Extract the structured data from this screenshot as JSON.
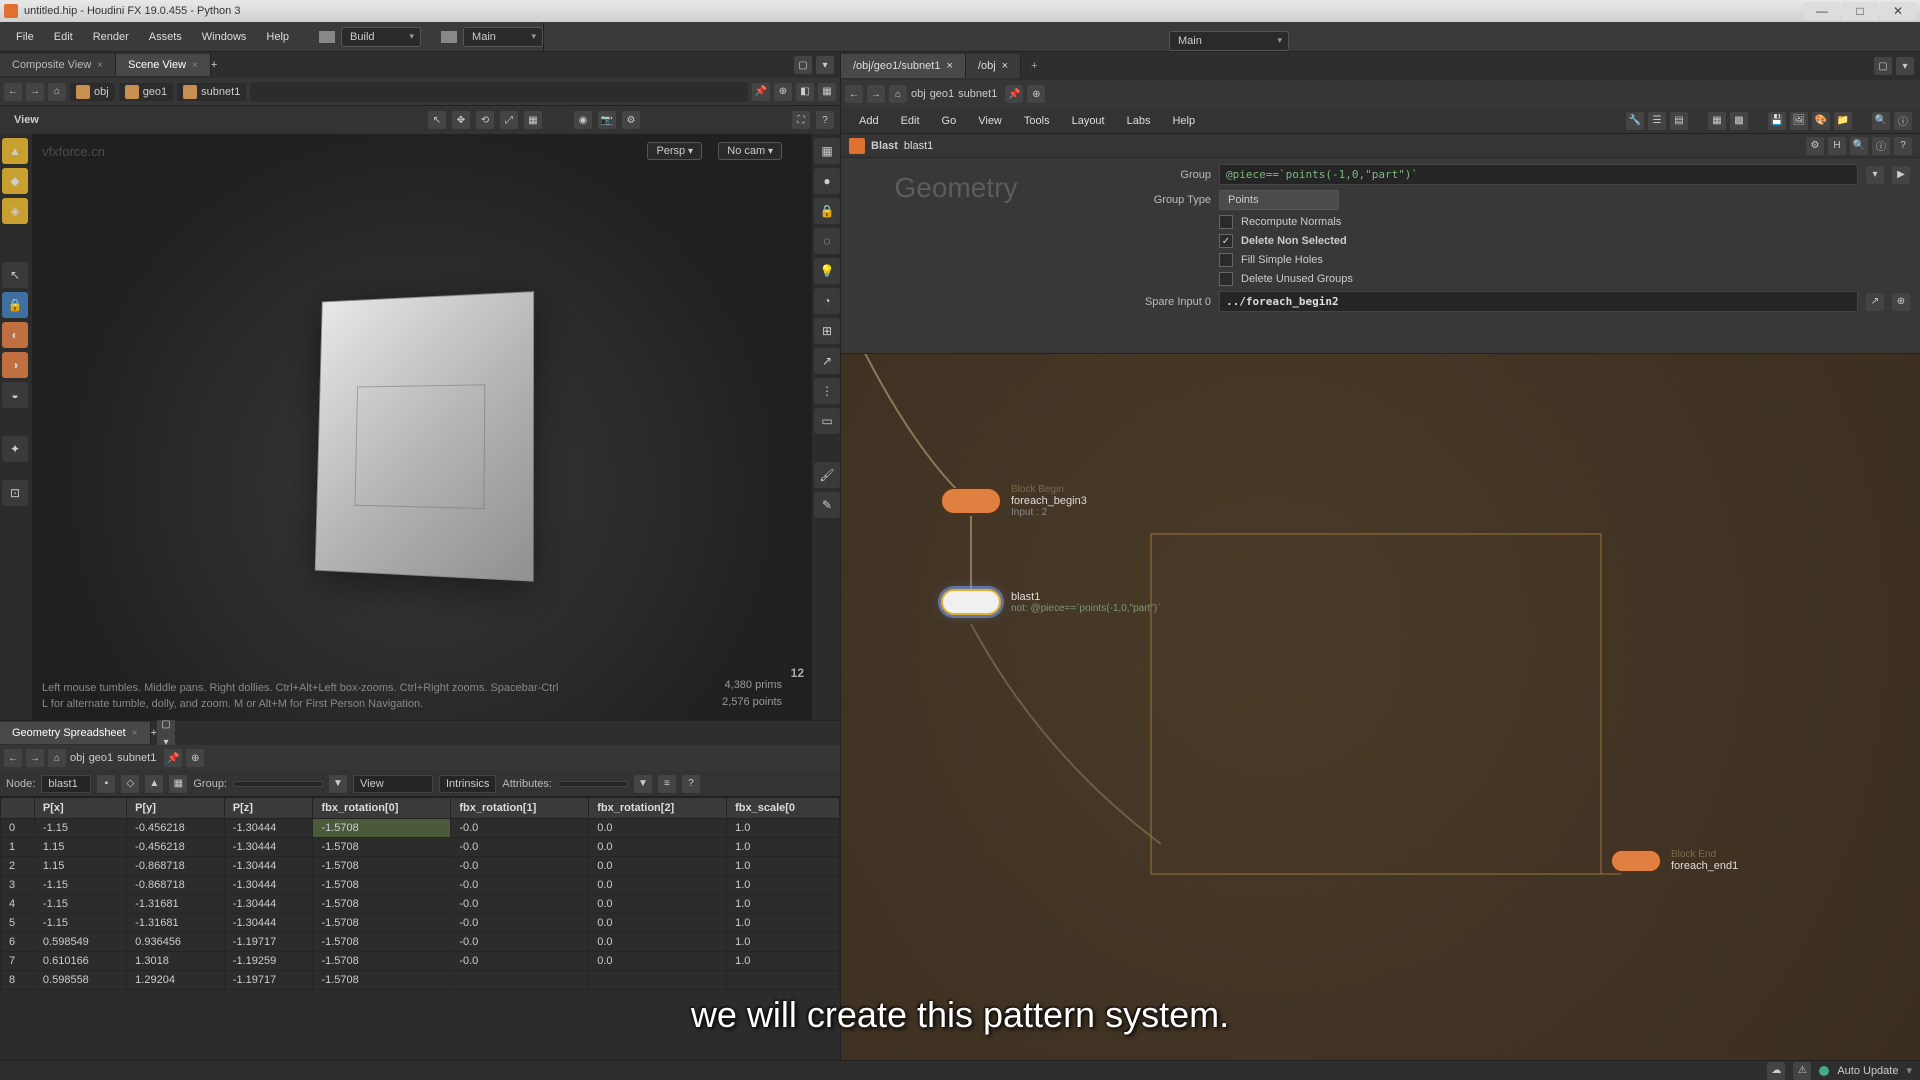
{
  "title": "untitled.hip - Houdini FX 19.0.455 - Python 3",
  "menubar": [
    "File",
    "Edit",
    "Render",
    "Assets",
    "Windows",
    "Help"
  ],
  "desktop_build": "Build",
  "desktop_main": "Main",
  "desktop_main2": "Main",
  "viewer_tabs": {
    "composite": "Composite View",
    "scene": "Scene View"
  },
  "path": {
    "obj": "obj",
    "geo1": "geo1",
    "subnet1": "subnet1"
  },
  "sv_toolbar": {
    "view": "View"
  },
  "viewport": {
    "watermark": "vfxforce.cn",
    "persp": "Persp",
    "cam": "No cam",
    "hint1": "Left mouse tumbles. Middle pans. Right dollies. Ctrl+Alt+Left box-zooms. Ctrl+Right zooms. Spacebar-Ctrl",
    "hint2": "L for alternate tumble, dolly, and zoom.    M or Alt+M for First Person Navigation.",
    "prims": "4,380  prims",
    "points": "2,576 points",
    "hud_num": "12"
  },
  "spreadsheet": {
    "tab": "Geometry Spreadsheet",
    "node_label": "Node:",
    "node_value": "blast1",
    "group_label": "Group:",
    "view": "View",
    "intrinsics": "Intrinsics",
    "attributes": "Attributes:",
    "cols": [
      "",
      "P[x]",
      "P[y]",
      "P[z]",
      "fbx_rotation[0]",
      "fbx_rotation[1]",
      "fbx_rotation[2]",
      "fbx_scale[0"
    ],
    "rows": [
      [
        "0",
        "-1.15",
        "-0.456218",
        "-1.30444",
        "-1.5708",
        "-0.0",
        "0.0",
        "1.0"
      ],
      [
        "1",
        "1.15",
        "-0.456218",
        "-1.30444",
        "-1.5708",
        "-0.0",
        "0.0",
        "1.0"
      ],
      [
        "2",
        "1.15",
        "-0.868718",
        "-1.30444",
        "-1.5708",
        "-0.0",
        "0.0",
        "1.0"
      ],
      [
        "3",
        "-1.15",
        "-0.868718",
        "-1.30444",
        "-1.5708",
        "-0.0",
        "0.0",
        "1.0"
      ],
      [
        "4",
        "-1.15",
        "-1.31681",
        "-1.30444",
        "-1.5708",
        "-0.0",
        "0.0",
        "1.0"
      ],
      [
        "5",
        "-1.15",
        "-1.31681",
        "-1.30444",
        "-1.5708",
        "-0.0",
        "0.0",
        "1.0"
      ],
      [
        "6",
        "0.598549",
        "0.936456",
        "-1.19717",
        "-1.5708",
        "-0.0",
        "0.0",
        "1.0"
      ],
      [
        "7",
        "0.610166",
        "1.3018",
        "-1.19259",
        "-1.5708",
        "-0.0",
        "0.0",
        "1.0"
      ],
      [
        "8",
        "0.598558",
        "1.29204",
        "-1.19717",
        "-1.5708",
        "",
        "",
        ""
      ]
    ]
  },
  "net": {
    "tab1": "/obj/geo1/subnet1",
    "tab2": "/obj",
    "menubar": [
      "Add",
      "Edit",
      "Go",
      "View",
      "Tools",
      "Layout",
      "Labs",
      "Help"
    ],
    "geom_label": "Geometry"
  },
  "params": {
    "node_type": "Blast",
    "node_name": "blast1",
    "group_label": "Group",
    "group_value": "@piece==`points(-1,0,\"part\")`",
    "group_type_label": "Group Type",
    "group_type_value": "Points",
    "recompute": "Recompute Normals",
    "delete_non": "Delete Non Selected",
    "fill_holes": "Fill Simple Holes",
    "delete_unused": "Delete Unused Groups",
    "spare_label": "Spare Input 0",
    "spare_value": "../foreach_begin2"
  },
  "nodes": {
    "foreach_begin3": {
      "label": "foreach_begin3",
      "sub": "Input : 2",
      "block": "Block Begin"
    },
    "blast1": {
      "label": "blast1",
      "sub": "not: @piece==`points(-1,0,\"part\")`"
    },
    "foreach_end1": {
      "label": "foreach_end1",
      "block": "Block End"
    }
  },
  "subtitle": "we will create this pattern system.",
  "status": {
    "auto": "Auto Update"
  }
}
